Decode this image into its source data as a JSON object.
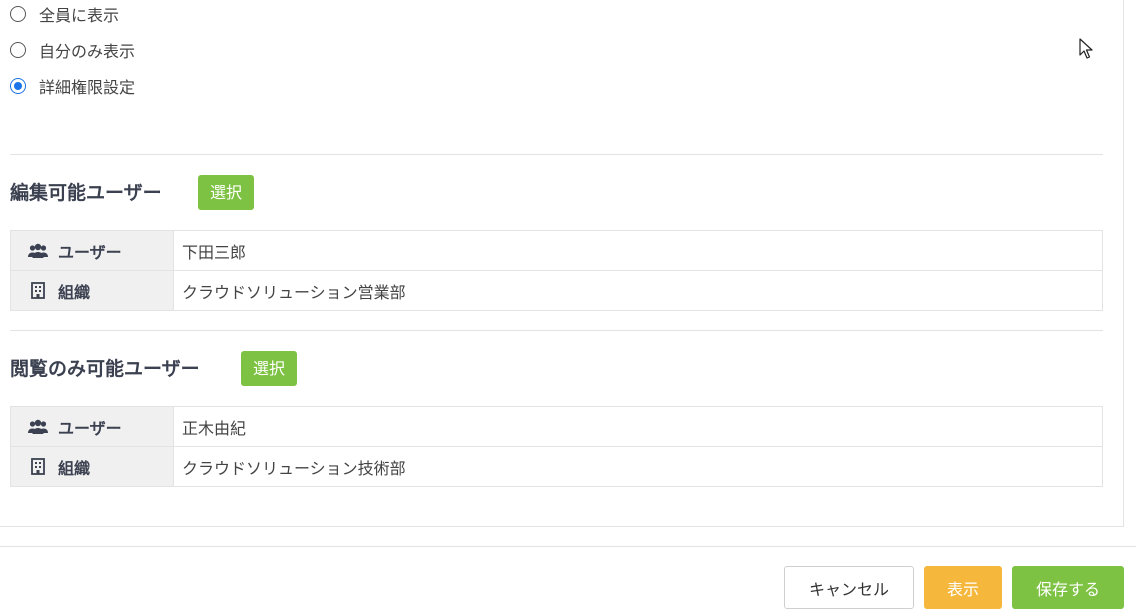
{
  "visibility": {
    "options": [
      {
        "label": "全員に表示",
        "checked": false
      },
      {
        "label": "自分のみ表示",
        "checked": false
      },
      {
        "label": "詳細権限設定",
        "checked": true
      }
    ]
  },
  "edit_section": {
    "title": "編集可能ユーザー",
    "select_label": "選択",
    "user_label": "ユーザー",
    "user_value": "下田三郎",
    "org_label": "組織",
    "org_value": "クラウドソリューション営業部"
  },
  "view_section": {
    "title": "閲覧のみ可能ユーザー",
    "select_label": "選択",
    "user_label": "ユーザー",
    "user_value": "正木由紀",
    "org_label": "組織",
    "org_value": "クラウドソリューション技術部"
  },
  "footer": {
    "cancel_label": "キャンセル",
    "show_label": "表示",
    "save_label": "保存する"
  },
  "icons": {
    "users": "users-icon",
    "org": "building-icon"
  },
  "colors": {
    "accent_green": "#7dc242",
    "accent_orange": "#f5b83d",
    "radio_blue": "#1a73e8"
  }
}
